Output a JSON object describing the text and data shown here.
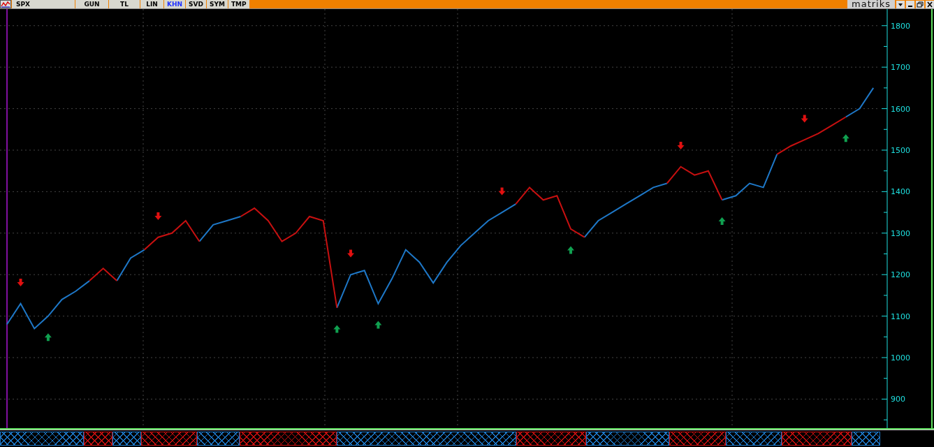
{
  "toolbar": {
    "symbol": "SPX",
    "tabs": [
      {
        "label": "GUN",
        "selected": false
      },
      {
        "label": "TL",
        "selected": false
      },
      {
        "label": "LIN",
        "selected": false
      },
      {
        "label": "KHN",
        "selected": true
      },
      {
        "label": "SVD",
        "selected": false
      },
      {
        "label": "SYM",
        "selected": false
      },
      {
        "label": "TMP",
        "selected": false
      }
    ],
    "brand": "matriks"
  },
  "chart_data": {
    "type": "line",
    "grid": true,
    "ylim": [
      830,
      1840
    ],
    "yticks": [
      900,
      1000,
      1100,
      1200,
      1300,
      1400,
      1500,
      1600,
      1700,
      1800
    ],
    "series": [
      {
        "color": "#1e78c8",
        "values": [
          1080,
          1130,
          1070,
          1100,
          1140,
          1160,
          1185,
          null,
          1185,
          1240,
          1260,
          null,
          null,
          null,
          1280,
          1320,
          1330,
          1340,
          null,
          null,
          null,
          null,
          null,
          null,
          1120,
          1200,
          1210,
          1130,
          1190,
          1260,
          1230,
          1180,
          1230,
          1270,
          1300,
          1330,
          1350,
          1370,
          null,
          null,
          null,
          null,
          1290,
          1330,
          1350,
          1370,
          1390,
          1410,
          1420,
          null,
          null,
          null,
          1380,
          1390,
          1420,
          1410,
          1490,
          null,
          null,
          null,
          null,
          1580,
          1600,
          1650
        ]
      },
      {
        "color": "#c81010",
        "values": [
          null,
          null,
          null,
          null,
          null,
          null,
          1185,
          1215,
          1185,
          null,
          1260,
          1290,
          1300,
          1330,
          1280,
          null,
          null,
          1340,
          1360,
          1330,
          1280,
          1300,
          1340,
          1330,
          1120,
          null,
          null,
          null,
          null,
          null,
          null,
          null,
          null,
          null,
          null,
          null,
          null,
          1370,
          1410,
          1380,
          1390,
          1310,
          1290,
          null,
          null,
          null,
          null,
          null,
          1420,
          1460,
          1440,
          1450,
          1380,
          null,
          null,
          null,
          1490,
          1510,
          1525,
          1540,
          1560,
          1580,
          null,
          null
        ]
      },
      {
        "type": "scatter",
        "color": "#e01010",
        "values": [
          null,
          1180,
          null,
          null,
          null,
          null,
          null,
          null,
          null,
          null,
          null,
          1340,
          null,
          null,
          null,
          null,
          null,
          null,
          null,
          null,
          null,
          null,
          null,
          null,
          null,
          1250,
          null,
          null,
          null,
          null,
          null,
          null,
          null,
          null,
          null,
          null,
          1400,
          null,
          null,
          null,
          null,
          null,
          null,
          null,
          null,
          null,
          null,
          null,
          null,
          1510,
          null,
          null,
          null,
          null,
          null,
          null,
          null,
          null,
          1575,
          null,
          null,
          null,
          null,
          null
        ]
      },
      {
        "type": "scatter",
        "color": "#10a050",
        "values": [
          null,
          null,
          null,
          1050,
          null,
          null,
          null,
          null,
          null,
          null,
          null,
          null,
          null,
          null,
          null,
          null,
          null,
          null,
          null,
          null,
          null,
          null,
          null,
          null,
          1070,
          null,
          null,
          1080,
          null,
          null,
          null,
          null,
          null,
          null,
          null,
          null,
          null,
          null,
          null,
          null,
          null,
          1260,
          null,
          null,
          null,
          null,
          null,
          null,
          null,
          null,
          null,
          null,
          1330,
          null,
          null,
          null,
          null,
          null,
          null,
          null,
          null,
          1530,
          null,
          null
        ]
      }
    ]
  }
}
